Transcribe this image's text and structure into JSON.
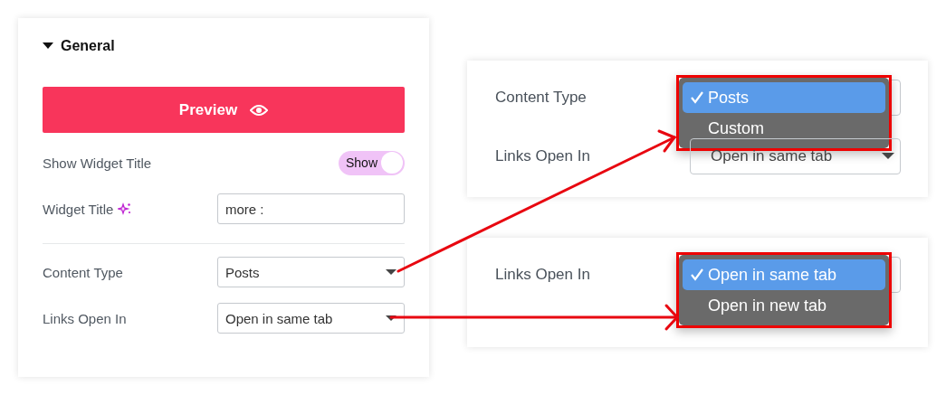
{
  "panel": {
    "section": {
      "title": "General",
      "expanded": true
    },
    "preview_button": {
      "label": "Preview"
    },
    "groups": [
      [
        {
          "kind": "toggle",
          "label": "Show Widget Title",
          "toggle_label": "Show",
          "on": true
        },
        {
          "kind": "text",
          "label": "Widget Title",
          "value": "more :"
        }
      ],
      [
        {
          "kind": "select",
          "label": "Content Type",
          "value": "Posts"
        },
        {
          "kind": "select",
          "label": "Links Open In",
          "value": "Open in same tab"
        }
      ]
    ]
  },
  "callouts": [
    {
      "rows": [
        {
          "label": "Content Type",
          "open": true,
          "options": [
            {
              "label": "Posts",
              "selected": true
            },
            {
              "label": "Custom",
              "selected": false
            }
          ]
        },
        {
          "label": "Links Open In",
          "open": false,
          "value": "Open in same tab"
        }
      ]
    },
    {
      "rows": [
        {
          "label": "Links Open In",
          "open": true,
          "options": [
            {
              "label": "Open in same tab",
              "selected": true
            },
            {
              "label": "Open in new tab",
              "selected": false
            }
          ]
        }
      ]
    }
  ]
}
